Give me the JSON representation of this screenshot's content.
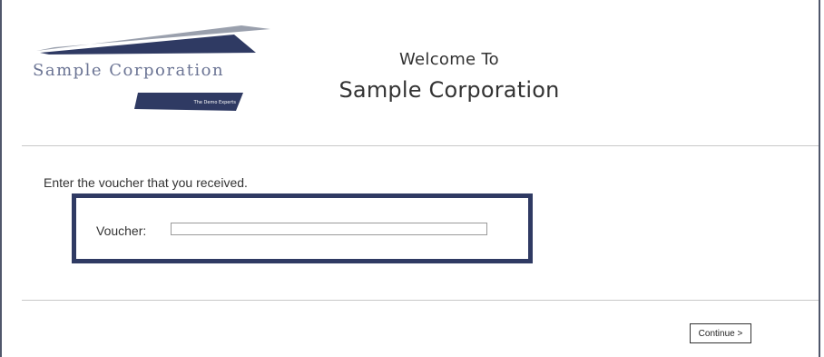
{
  "logo": {
    "name": "Sample Corporation",
    "tagline": "The Demo Experts",
    "colors": {
      "navy": "#2f3a63",
      "gray": "#9aa0ad",
      "text": "#6b7494"
    }
  },
  "header": {
    "welcome": "Welcome To",
    "company": "Sample Corporation"
  },
  "form": {
    "instruction": "Enter the voucher that you received.",
    "voucher_label": "Voucher:",
    "voucher_value": "",
    "continue_label": "Continue >"
  }
}
